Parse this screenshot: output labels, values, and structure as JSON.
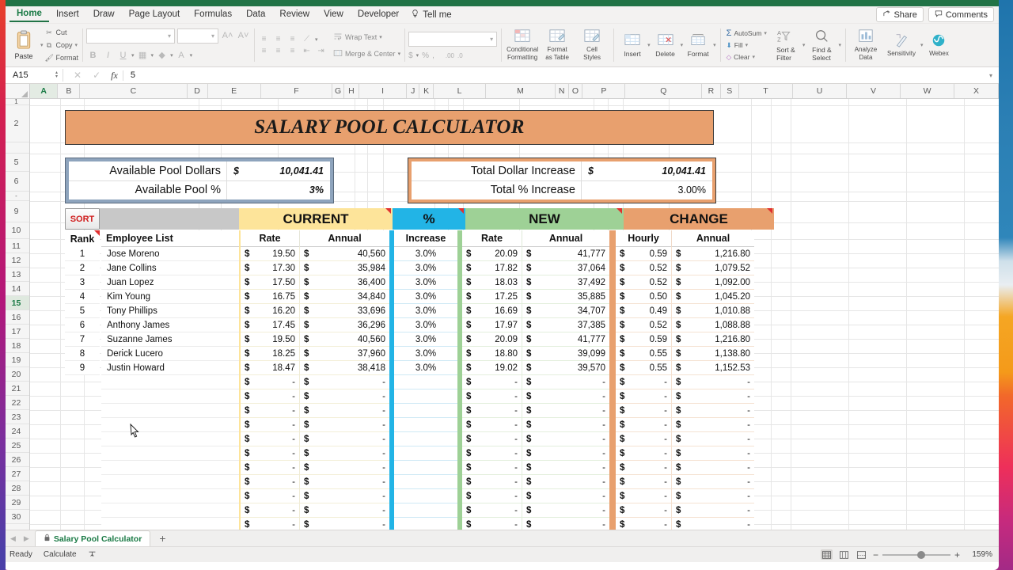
{
  "app": {
    "ribbon_tabs": [
      "Home",
      "Insert",
      "Draw",
      "Page Layout",
      "Formulas",
      "Data",
      "Review",
      "View",
      "Developer"
    ],
    "tell_me": "Tell me",
    "share_label": "Share",
    "comments_label": "Comments"
  },
  "ribbon": {
    "clipboard": {
      "paste": "Paste",
      "cut": "Cut",
      "copy": "Copy",
      "format_painter": "Format"
    },
    "styles": {
      "conditional_formatting": "Conditional\nFormatting",
      "format_as_table": "Format\nas Table",
      "cell_styles": "Cell\nStyles"
    },
    "cells": {
      "insert": "Insert",
      "delete": "Delete",
      "format": "Format"
    },
    "editing": {
      "autosum": "AutoSum",
      "fill": "Fill",
      "clear": "Clear",
      "sort_filter": "Sort &\nFilter",
      "find_select": "Find &\nSelect"
    },
    "analysis": {
      "analyze_data": "Analyze\nData",
      "sensitivity": "Sensitivity",
      "webex": "Webex"
    },
    "alignment": {
      "wrap_text": "Wrap Text",
      "merge_center": "Merge & Center"
    }
  },
  "formula_bar": {
    "name_box": "A15",
    "value": "5"
  },
  "grid": {
    "columns": [
      "A",
      "B",
      "C",
      "D",
      "E",
      "F",
      "G",
      "H",
      "I",
      "J",
      "K",
      "L",
      "M",
      "N",
      "O",
      "P",
      "Q",
      "R",
      "S",
      "T",
      "U",
      "V",
      "W",
      "X"
    ],
    "rows": [
      "1",
      "2",
      "5",
      "6",
      "-",
      "9",
      "10",
      "11",
      "12",
      "13",
      "14",
      "15",
      "16",
      "17",
      "18",
      "19",
      "20",
      "21",
      "22",
      "23",
      "24",
      "25",
      "26",
      "27",
      "28",
      "29",
      "30"
    ],
    "selected_row": "15",
    "selected_column": "A"
  },
  "sheet": {
    "title": "SALARY POOL CALCULATOR",
    "pool_panel": [
      {
        "label": "Available Pool Dollars",
        "currency": "$",
        "value": "10,041.41"
      },
      {
        "label": "Available Pool %",
        "currency": "",
        "value": "3%"
      }
    ],
    "increase_panel": [
      {
        "label": "Total Dollar Increase",
        "currency": "$",
        "value": "10,041.41"
      },
      {
        "label": "Total % Increase",
        "currency": "",
        "value": "3.00%"
      }
    ],
    "sort_button": "SORT",
    "bands": [
      {
        "title": "",
        "color": "#c8c8c8"
      },
      {
        "title": "CURRENT",
        "color": "#fde49a"
      },
      {
        "title": "%",
        "color": "#22b4e6"
      },
      {
        "title": "NEW",
        "color": "#9ed196"
      },
      {
        "title": "CHANGE",
        "color": "#e8a06e"
      }
    ],
    "headers": {
      "rank": "Rank",
      "employee_list": "Employee List",
      "current_rate": "Rate",
      "current_annual": "Annual",
      "pct_increase": "Increase",
      "new_rate": "Rate",
      "new_annual": "Annual",
      "change_hourly": "Hourly",
      "change_annual": "Annual"
    },
    "currency_symbol": "$",
    "dash": "-",
    "rows": [
      {
        "rank": "1",
        "name": "Jose Moreno",
        "cur_rate": "19.50",
        "cur_annual": "40,560",
        "increase": "3.0%",
        "new_rate": "20.09",
        "new_annual": "41,777",
        "chg_hourly": "0.59",
        "chg_annual": "1,216.80"
      },
      {
        "rank": "2",
        "name": "Jane Collins",
        "cur_rate": "17.30",
        "cur_annual": "35,984",
        "increase": "3.0%",
        "new_rate": "17.82",
        "new_annual": "37,064",
        "chg_hourly": "0.52",
        "chg_annual": "1,079.52"
      },
      {
        "rank": "3",
        "name": "Juan Lopez",
        "cur_rate": "17.50",
        "cur_annual": "36,400",
        "increase": "3.0%",
        "new_rate": "18.03",
        "new_annual": "37,492",
        "chg_hourly": "0.52",
        "chg_annual": "1,092.00"
      },
      {
        "rank": "4",
        "name": "Kim Young",
        "cur_rate": "16.75",
        "cur_annual": "34,840",
        "increase": "3.0%",
        "new_rate": "17.25",
        "new_annual": "35,885",
        "chg_hourly": "0.50",
        "chg_annual": "1,045.20"
      },
      {
        "rank": "5",
        "name": "Tony Phillips",
        "cur_rate": "16.20",
        "cur_annual": "33,696",
        "increase": "3.0%",
        "new_rate": "16.69",
        "new_annual": "34,707",
        "chg_hourly": "0.49",
        "chg_annual": "1,010.88"
      },
      {
        "rank": "6",
        "name": "Anthony James",
        "cur_rate": "17.45",
        "cur_annual": "36,296",
        "increase": "3.0%",
        "new_rate": "17.97",
        "new_annual": "37,385",
        "chg_hourly": "0.52",
        "chg_annual": "1,088.88"
      },
      {
        "rank": "7",
        "name": "Suzanne James",
        "cur_rate": "19.50",
        "cur_annual": "40,560",
        "increase": "3.0%",
        "new_rate": "20.09",
        "new_annual": "41,777",
        "chg_hourly": "0.59",
        "chg_annual": "1,216.80"
      },
      {
        "rank": "8",
        "name": "Derick Lucero",
        "cur_rate": "18.25",
        "cur_annual": "37,960",
        "increase": "3.0%",
        "new_rate": "18.80",
        "new_annual": "39,099",
        "chg_hourly": "0.55",
        "chg_annual": "1,138.80"
      },
      {
        "rank": "9",
        "name": "Justin Howard",
        "cur_rate": "18.47",
        "cur_annual": "38,418",
        "increase": "3.0%",
        "new_rate": "19.02",
        "new_annual": "39,570",
        "chg_hourly": "0.55",
        "chg_annual": "1,152.53"
      }
    ],
    "empty_row_count": 11
  },
  "sheet_tabs": {
    "active": "Salary Pool Calculator",
    "add_label": "+"
  },
  "status_bar": {
    "mode": "Ready",
    "calc": "Calculate",
    "zoom": "159%",
    "zoom_minus": "−",
    "zoom_plus": "+"
  }
}
